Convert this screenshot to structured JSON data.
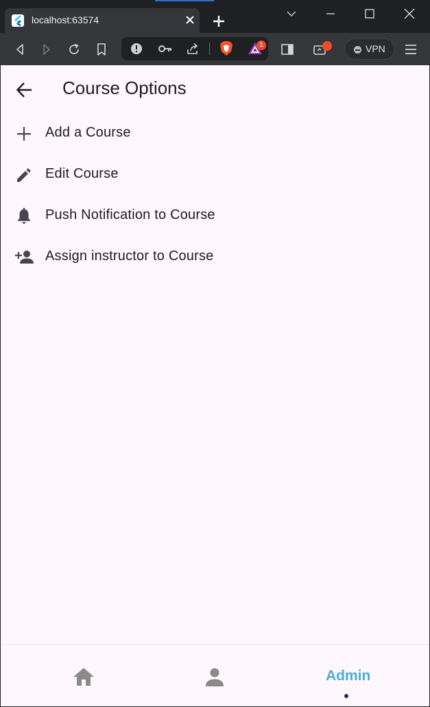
{
  "browser": {
    "tab_title": "localhost:63574",
    "vpn_label": "VPN",
    "rewards_badge": "1"
  },
  "appbar": {
    "title": "Course Options"
  },
  "menu": {
    "items": [
      {
        "label": "Add a Course",
        "icon": "add-icon"
      },
      {
        "label": "Edit Course",
        "icon": "edit-icon"
      },
      {
        "label": "Push Notification to Course",
        "icon": "bell-icon"
      },
      {
        "label": "Assign instructor to Course",
        "icon": "person-add-icon"
      }
    ]
  },
  "bottom_nav": {
    "items": [
      {
        "icon": "home-icon",
        "selected": false
      },
      {
        "icon": "person-icon",
        "selected": false
      },
      {
        "label": "Admin",
        "selected": true
      }
    ]
  },
  "colors": {
    "page_background": "#fef8fd",
    "text_primary": "#1d1b20",
    "nav_inactive": "#8a8a8a",
    "nav_active": "#4aaedb",
    "nav_indicator": "#1c2a6b",
    "browser_dark": "#1f2023",
    "browser_tab": "#35363a"
  }
}
